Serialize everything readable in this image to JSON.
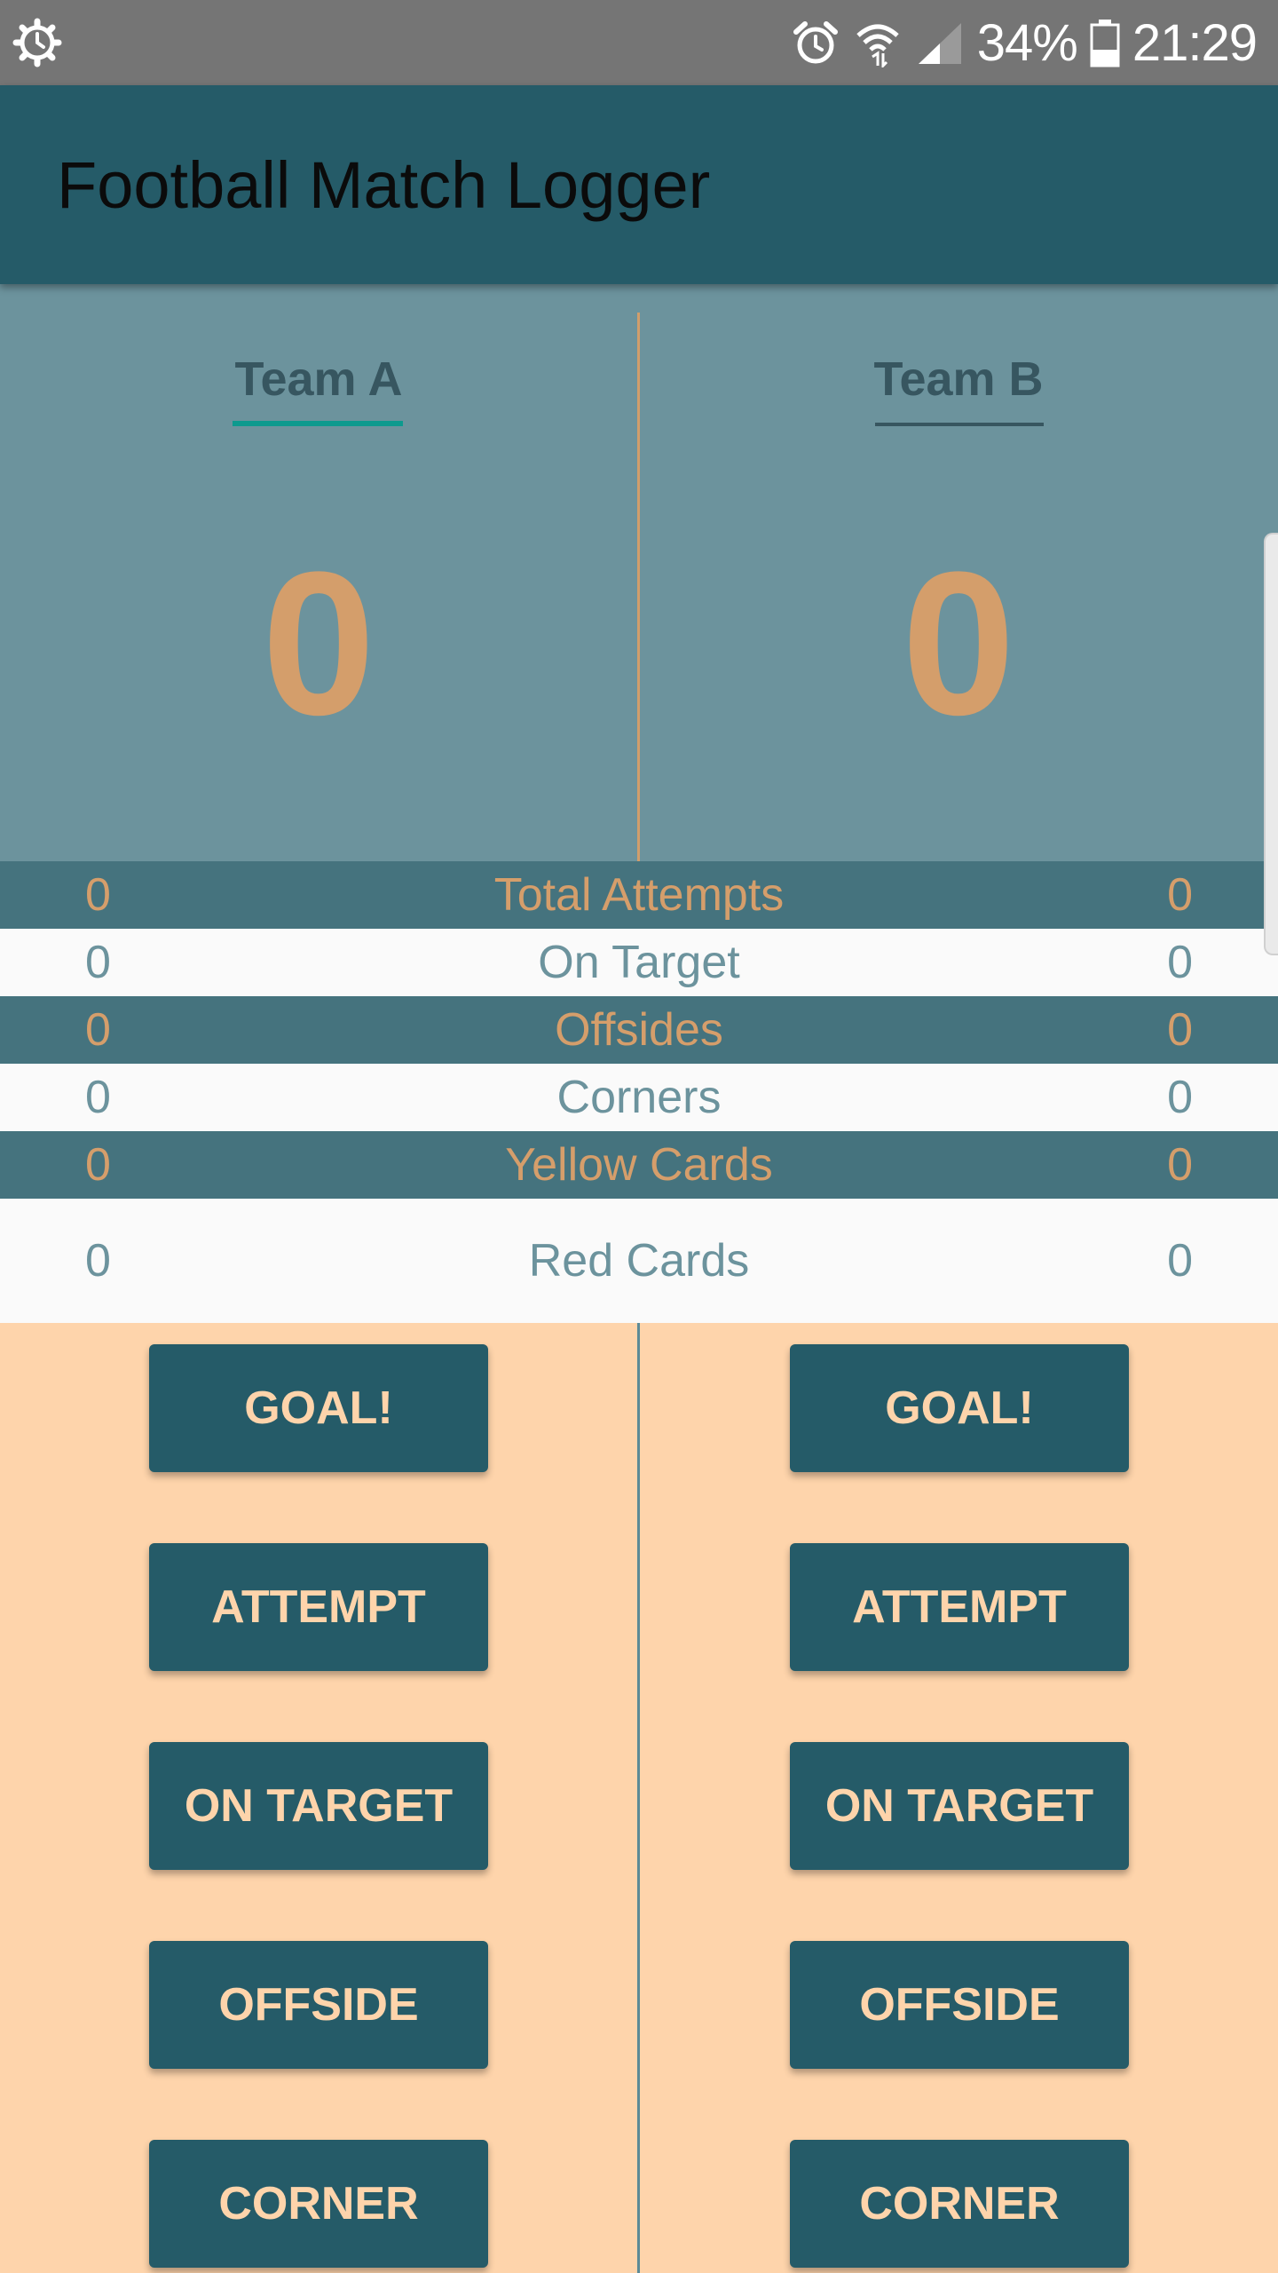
{
  "status_bar": {
    "battery_percent": "34%",
    "time": "21:29",
    "icons": [
      "settings-gear-icon",
      "alarm-icon",
      "wifi-icon",
      "signal-icon",
      "battery-icon"
    ]
  },
  "app": {
    "title": "Football Match Logger"
  },
  "teams": {
    "a": {
      "name": "Team A",
      "score": "0"
    },
    "b": {
      "name": "Team B",
      "score": "0"
    }
  },
  "stats": [
    {
      "label": "Total Attempts",
      "a": "0",
      "b": "0"
    },
    {
      "label": "On Target",
      "a": "0",
      "b": "0"
    },
    {
      "label": "Offsides",
      "a": "0",
      "b": "0"
    },
    {
      "label": "Corners",
      "a": "0",
      "b": "0"
    },
    {
      "label": "Yellow Cards",
      "a": "0",
      "b": "0"
    },
    {
      "label": "Red Cards",
      "a": "0",
      "b": "0"
    }
  ],
  "buttons": {
    "goal": "GOAL!",
    "attempt": "ATTEMPT",
    "on_target": "ON TARGET",
    "offside": "OFFSIDE",
    "corner": "CORNER"
  },
  "colors": {
    "app_bar": "#255B68",
    "scoreboard": "#6C939D",
    "score": "#D49E6B",
    "stat_dark_row": "#45737E",
    "stat_light_row": "#FAFAFA",
    "button_bg": "#255B68",
    "button_text": "#FED4AB",
    "page_bg": "#FED4AB",
    "tab_indicator": "#0D9A8E"
  }
}
